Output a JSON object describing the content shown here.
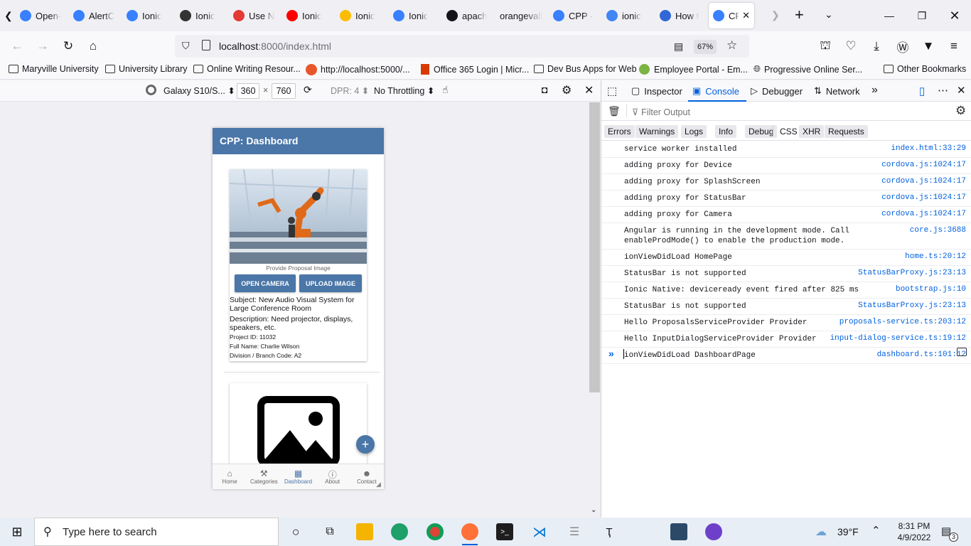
{
  "browser": {
    "tabs": [
      {
        "label": "Open-",
        "icon": "ionic-icon",
        "color": "#3880ff"
      },
      {
        "label": "AlertC",
        "icon": "ionic-icon",
        "color": "#3880ff"
      },
      {
        "label": "Ionic",
        "icon": "ionic-icon",
        "color": "#3880ff"
      },
      {
        "label": "Ionic",
        "icon": "globe-icon",
        "color": "#333333"
      },
      {
        "label": "Use N",
        "icon": "flag-icon",
        "color": "#e53935"
      },
      {
        "label": "Ionic",
        "icon": "youtube-icon",
        "color": "#ff0000"
      },
      {
        "label": "Ionic",
        "icon": "drive-icon",
        "color": "#fbbc04"
      },
      {
        "label": "Ionic",
        "icon": "ionic-icon",
        "color": "#3880ff"
      },
      {
        "label": "apach",
        "icon": "github-icon",
        "color": "#15141a"
      },
      {
        "label": "orangevall",
        "icon": "none",
        "color": "#f0f0f4"
      },
      {
        "label": "CPP -",
        "icon": "ionic-icon",
        "color": "#3880ff"
      },
      {
        "label": "ionic",
        "icon": "google-icon",
        "color": "#4285f4"
      },
      {
        "label": "How t",
        "icon": "ed-icon",
        "color": "#3367d6"
      },
      {
        "label": "CPP",
        "icon": "ionic-icon",
        "color": "#3880ff"
      }
    ],
    "url": "localhost:8000/index.html",
    "url_host": "localhost",
    "url_rest": ":8000/index.html",
    "zoom": "67%",
    "bookmarks": [
      "Maryville University",
      "University Library",
      "Online Writing Resour...",
      "http://localhost:5000/...",
      "Office 365 Login | Micr...",
      "Dev Bus Apps for Web",
      "Employee Portal - Em...",
      "Progressive Online Ser...",
      "Other Bookmarks"
    ]
  },
  "rdm": {
    "device": "Galaxy S10/S...",
    "width": "360",
    "times": "×",
    "height": "760",
    "dpr": "DPR: 4",
    "throttling": "No Throttling"
  },
  "app": {
    "title": "CPP: Dashboard",
    "image_caption": "Provide Proposal Image",
    "open_camera": "OPEN CAMERA",
    "upload_image": "UPLOAD IMAGE",
    "subject": "Subject: New Audio Visual System for Large Conference Room",
    "description": "Description: Need projector, displays, speakers, etc.",
    "project_id": "Project ID: 11032",
    "full_name": "Full Name: Charlie Wilson",
    "division": "Division / Branch Code: A2",
    "fab": "+",
    "tabs": [
      {
        "label": "Home",
        "icon": "home-icon"
      },
      {
        "label": "Categories",
        "icon": "tools-icon"
      },
      {
        "label": "Dashboard",
        "icon": "grid-icon"
      },
      {
        "label": "About",
        "icon": "info-icon"
      },
      {
        "label": "Contact",
        "icon": "people-icon"
      }
    ]
  },
  "devtools": {
    "tabs": [
      "Inspector",
      "Console",
      "Debugger",
      "Network"
    ],
    "filter_placeholder": "Filter Output",
    "levels": [
      "Errors",
      "Warnings",
      "Logs",
      "Info",
      "Debug"
    ],
    "extra_levels": [
      "CSS",
      "XHR",
      "Requests"
    ],
    "messages": [
      {
        "text": "service worker installed",
        "source": "index.html:33:29"
      },
      {
        "text": "adding proxy for Device",
        "source": "cordova.js:1024:17"
      },
      {
        "text": "adding proxy for SplashScreen",
        "source": "cordova.js:1024:17"
      },
      {
        "text": "adding proxy for StatusBar",
        "source": "cordova.js:1024:17"
      },
      {
        "text": "adding proxy for Camera",
        "source": "cordova.js:1024:17"
      },
      {
        "text": "Angular is running in the development mode. Call enableProdMode() to enable the production mode.",
        "source": "core.js:3688"
      },
      {
        "text": "ionViewDidLoad HomePage",
        "source": "home.ts:20:12"
      },
      {
        "text": "StatusBar is not supported",
        "source": "StatusBarProxy.js:23:13"
      },
      {
        "text": "Ionic Native: deviceready event fired after 825 ms",
        "source": "bootstrap.js:10"
      },
      {
        "text": "StatusBar is not supported",
        "source": "StatusBarProxy.js:23:13"
      },
      {
        "text": "Hello ProposalsServiceProvider Provider",
        "source": "proposals-service.ts:203:12"
      },
      {
        "text": "Hello InputDialogServiceProvider Provider",
        "source": "input-dialog-service.ts:19:12"
      },
      {
        "text": "ionViewDidLoad DashboardPage",
        "source": "dashboard.ts:101:12"
      }
    ]
  },
  "taskbar": {
    "search_placeholder": "Type here to search",
    "weather": "39°F",
    "time": "8:31 PM",
    "date": "4/9/2022",
    "notifications": "3"
  },
  "colors": {
    "app_primary": "#4a76a8",
    "firefox_accent": "#0060df"
  }
}
